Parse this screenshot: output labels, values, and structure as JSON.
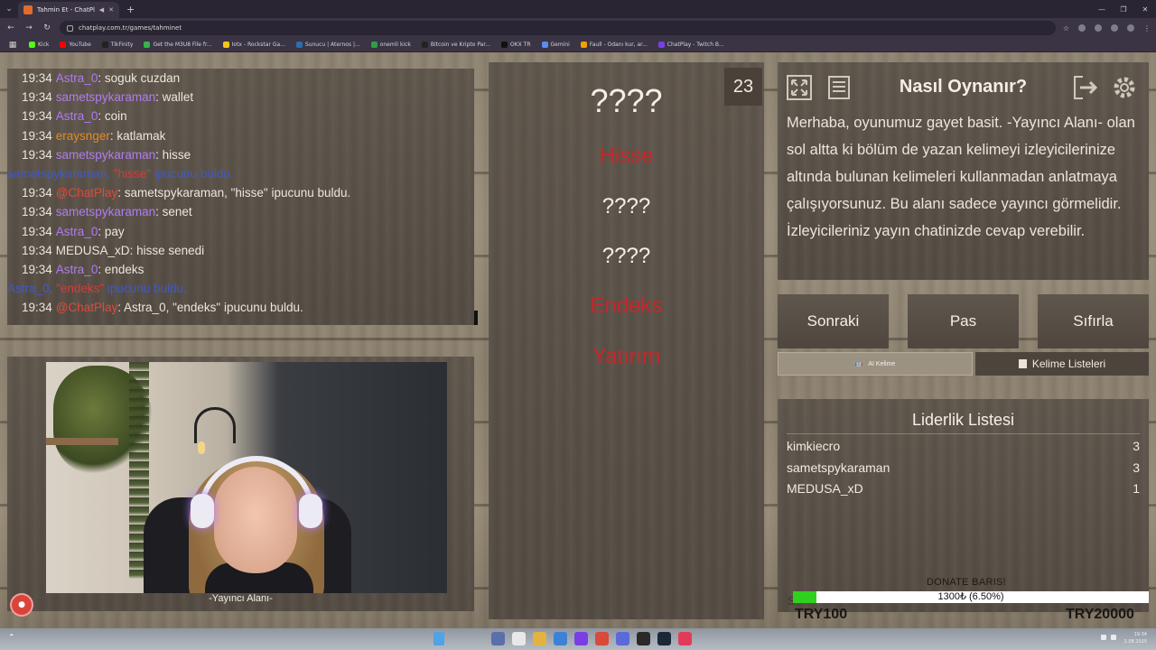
{
  "browser": {
    "tab_title": "Tahmin Et - ChatPlay",
    "url": "chatplay.com.tr/games/tahminet",
    "bookmarks": [
      {
        "label": "Kick",
        "color": "#53fc18"
      },
      {
        "label": "YouTube",
        "color": "#ff0000"
      },
      {
        "label": "TikFinity",
        "color": "#222222"
      },
      {
        "label": "Get the M3U8 File fr...",
        "color": "#37b24d"
      },
      {
        "label": "Iotx - Rockstar Ga...",
        "color": "#f5c518"
      },
      {
        "label": "Sunucu | Aternos |...",
        "color": "#2b6cb0"
      },
      {
        "label": "onemli kick",
        "color": "#2f9e44"
      },
      {
        "label": "Bitcoin ve Kripto Par...",
        "color": "#222222"
      },
      {
        "label": "OKX TR",
        "color": "#111111"
      },
      {
        "label": "Gemini",
        "color": "#5b8def"
      },
      {
        "label": "Faull - Odanı kur, ar...",
        "color": "#f59f00"
      },
      {
        "label": "ChatPlay - Twitch B...",
        "color": "#7b3fe4"
      }
    ]
  },
  "chat": {
    "lines": [
      {
        "time": "19:34",
        "user": "Astra_0",
        "user_color": "#b07cf0",
        "sep": ": ",
        "text": "soguk cuzdan"
      },
      {
        "time": "19:34",
        "user": "sametspykaraman",
        "user_color": "#b07cf0",
        "sep": ": ",
        "text": "wallet"
      },
      {
        "time": "19:34",
        "user": "Astra_0",
        "user_color": "#b07cf0",
        "sep": ": ",
        "text": "coin"
      },
      {
        "time": "19:34",
        "user": "eraysnger",
        "user_color": "#e08a2a",
        "sep": ": ",
        "text": "katlamak"
      },
      {
        "time": "19:34",
        "user": "sametspykaraman",
        "user_color": "#b07cf0",
        "sep": ": ",
        "text": "hisse"
      },
      {
        "system": true,
        "pre": "sametspykaraman, ",
        "hl": "\"hisse\"",
        "post": " ipucunu buldu."
      },
      {
        "time": "19:34",
        "user": "@ChatPlay",
        "user_color": "#e04a3a",
        "sep": ": ",
        "text": "sametspykaraman, \"hisse\" ipucunu buldu."
      },
      {
        "time": "19:34",
        "user": "sametspykaraman",
        "user_color": "#b07cf0",
        "sep": ": ",
        "text": "senet"
      },
      {
        "time": "19:34",
        "user": "Astra_0",
        "user_color": "#b07cf0",
        "sep": ": ",
        "text": "pay"
      },
      {
        "time": "19:34",
        "user": "MEDUSA_xD",
        "user_color": "#ece6dc",
        "sep": ": ",
        "text": "hisse senedi"
      },
      {
        "time": "19:34",
        "user": "Astra_0",
        "user_color": "#b07cf0",
        "sep": ": ",
        "text": "endeks"
      },
      {
        "system": true,
        "pre": "Astra_0, ",
        "hl": "\"endeks\"",
        "post": " ipucunu buldu."
      },
      {
        "time": "19:34",
        "user": "@ChatPlay",
        "user_color": "#e04a3a",
        "sep": ": ",
        "text": "Astra_0, \"endeks\" ipucunu buldu."
      }
    ]
  },
  "webcam": {
    "label": "-Yayıncı Alanı-"
  },
  "game": {
    "timer": "23",
    "main_word": "????",
    "clues": [
      {
        "text": "Hisse",
        "found": true
      },
      {
        "text": "????",
        "found": false
      },
      {
        "text": "????",
        "found": false
      },
      {
        "text": "Endeks",
        "found": true
      },
      {
        "text": "Yatırım",
        "found": true
      }
    ]
  },
  "howto": {
    "title": "Nasıl Oynanır?",
    "text": "Merhaba, oyunumuz gayet basit. -Yayıncı Alanı- olan sol altta ki bölüm de yazan kelimeyi izleyicilerinize altında bulunan kelimeleri kullanmadan anlatmaya çalışıyorsunuz. Bu alanı sadece yayıncı görmelidir. İzleyicileriniz yayın chatinizde cevap verebilir."
  },
  "controls": {
    "next": "Sonraki",
    "pass": "Pas",
    "reset": "Sıfırla",
    "ai_words": "AI Kelime",
    "word_lists": "Kelime Listeleri"
  },
  "leaderboard": {
    "title": "Liderlik Listesi",
    "rows": [
      {
        "name": "kimkiecro",
        "score": "3"
      },
      {
        "name": "sametspykaraman",
        "score": "3"
      },
      {
        "name": "MEDUSA_xD",
        "score": "1"
      }
    ]
  },
  "donate": {
    "title": "DONATE BARIS!",
    "progress_text": "1300₺ (6.50%)",
    "progress_fraction": 0.065,
    "min": "TRY100",
    "max": "TRY20000"
  },
  "taskbar": {
    "clock_time": "19:34",
    "clock_date": "2.08.2025"
  },
  "colors": {
    "found_clue": "#c8262a",
    "system_msg": "#3f59c8",
    "donate_fill": "#2fd11e"
  }
}
